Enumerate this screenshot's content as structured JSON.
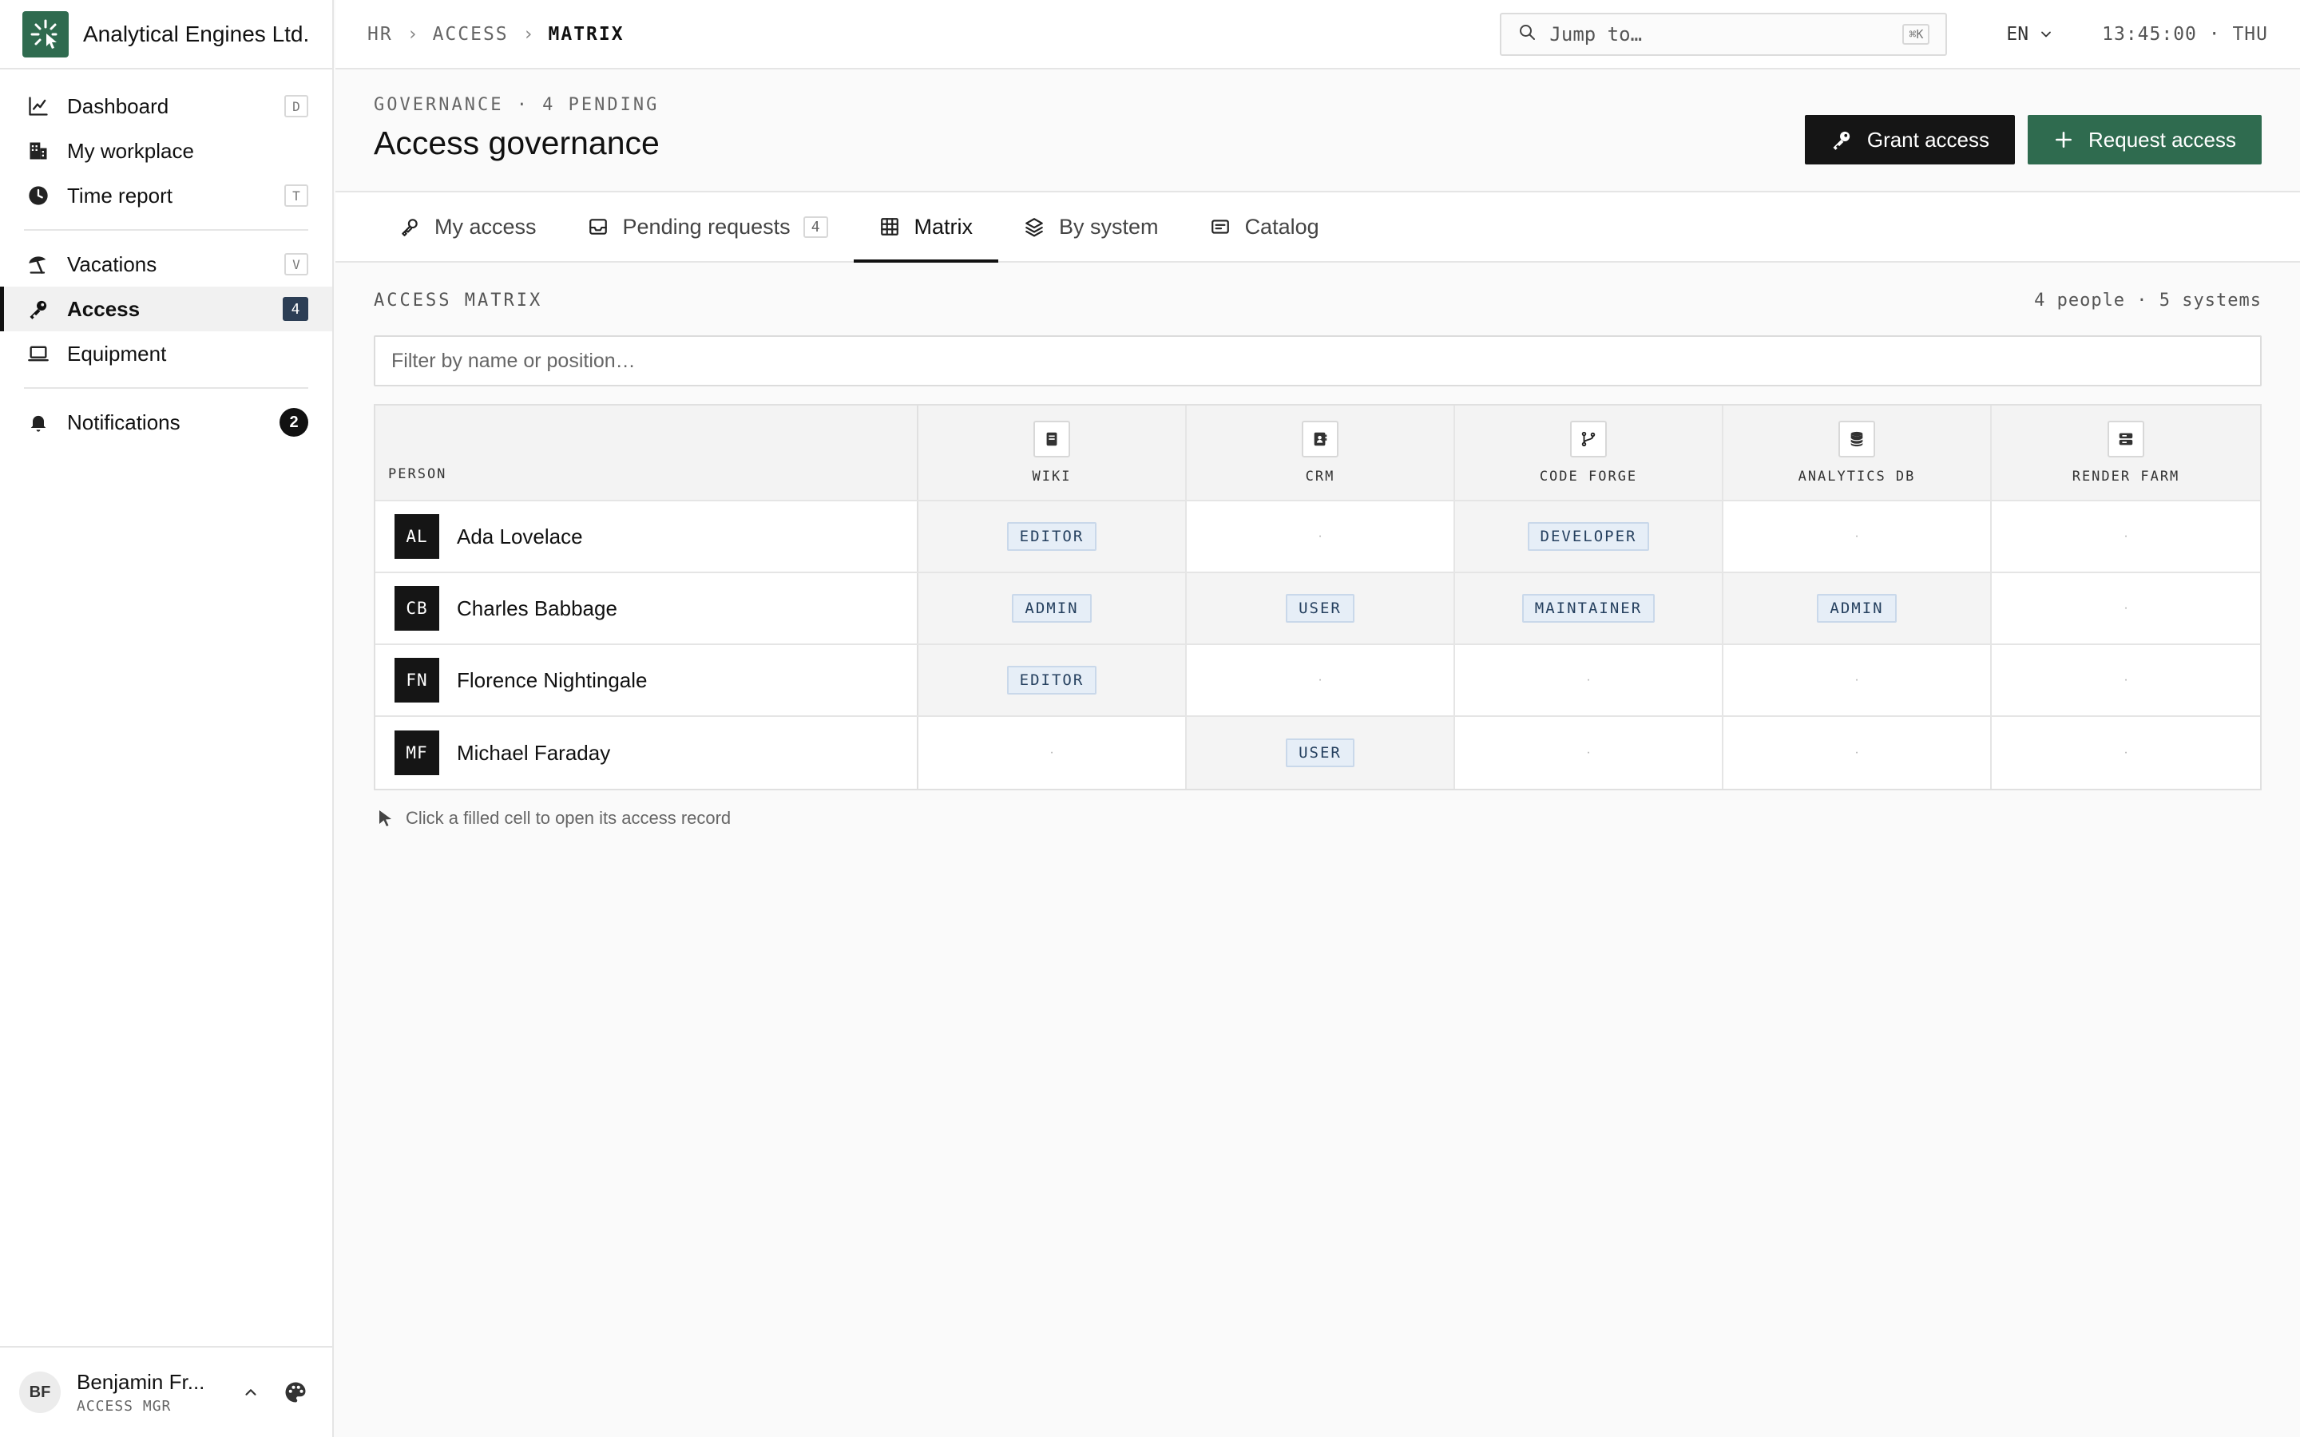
{
  "brand": {
    "name": "Analytical Engines Ltd."
  },
  "sidebar": {
    "groups": [
      [
        {
          "label": "Dashboard",
          "icon": "chart-line-icon",
          "shortcut": "D"
        },
        {
          "label": "My workplace",
          "icon": "building-icon"
        },
        {
          "label": "Time report",
          "icon": "clock-icon",
          "shortcut": "T"
        }
      ],
      [
        {
          "label": "Vacations",
          "icon": "umbrella-icon",
          "shortcut": "V"
        },
        {
          "label": "Access",
          "icon": "key-icon",
          "badge": "4",
          "active": true
        },
        {
          "label": "Equipment",
          "icon": "laptop-icon"
        }
      ],
      [
        {
          "label": "Notifications",
          "icon": "bell-icon",
          "badge": "2"
        }
      ]
    ]
  },
  "user": {
    "initials": "BF",
    "name": "Benjamin Fr...",
    "role": "ACCESS MGR"
  },
  "topbar": {
    "breadcrumb": [
      "HR",
      "ACCESS",
      "MATRIX"
    ],
    "search_placeholder": "Jump to…",
    "search_shortcut": "⌘K",
    "language": "EN",
    "clock": "13:45:00 · THU"
  },
  "header": {
    "eyebrow": "GOVERNANCE · 4 PENDING",
    "title": "Access governance",
    "grant_label": "Grant access",
    "request_label": "Request access"
  },
  "tabs": [
    {
      "label": "My access",
      "icon": "key-outline-icon"
    },
    {
      "label": "Pending requests",
      "icon": "inbox-icon",
      "count": "4"
    },
    {
      "label": "Matrix",
      "icon": "grid-icon",
      "active": true
    },
    {
      "label": "By system",
      "icon": "layers-icon"
    },
    {
      "label": "Catalog",
      "icon": "catalog-icon"
    }
  ],
  "matrix": {
    "title": "ACCESS MATRIX",
    "meta": "4 people · 5 systems",
    "filter_placeholder": "Filter by name or position…",
    "person_header": "PERSON",
    "systems": [
      {
        "name": "WIKI",
        "icon": "book-icon"
      },
      {
        "name": "CRM",
        "icon": "contacts-icon"
      },
      {
        "name": "CODE FORGE",
        "icon": "git-branch-icon"
      },
      {
        "name": "ANALYTICS DB",
        "icon": "database-icon"
      },
      {
        "name": "RENDER FARM",
        "icon": "server-icon"
      }
    ],
    "rows": [
      {
        "initials": "AL",
        "name": "Ada Lovelace",
        "cells": [
          "EDITOR",
          "",
          "DEVELOPER",
          "",
          ""
        ]
      },
      {
        "initials": "CB",
        "name": "Charles Babbage",
        "cells": [
          "ADMIN",
          "USER",
          "MAINTAINER",
          "ADMIN",
          ""
        ]
      },
      {
        "initials": "FN",
        "name": "Florence Nightingale",
        "cells": [
          "EDITOR",
          "",
          "",
          "",
          ""
        ]
      },
      {
        "initials": "MF",
        "name": "Michael Faraday",
        "cells": [
          "",
          "USER",
          "",
          "",
          ""
        ]
      }
    ],
    "empty_mark": "·",
    "hint": "Click a filled cell to open its access record"
  },
  "colors": {
    "accent": "#2f6b4f",
    "dark": "#151515",
    "badge": "#2c3e55",
    "chip_bg": "#e6eef7"
  }
}
